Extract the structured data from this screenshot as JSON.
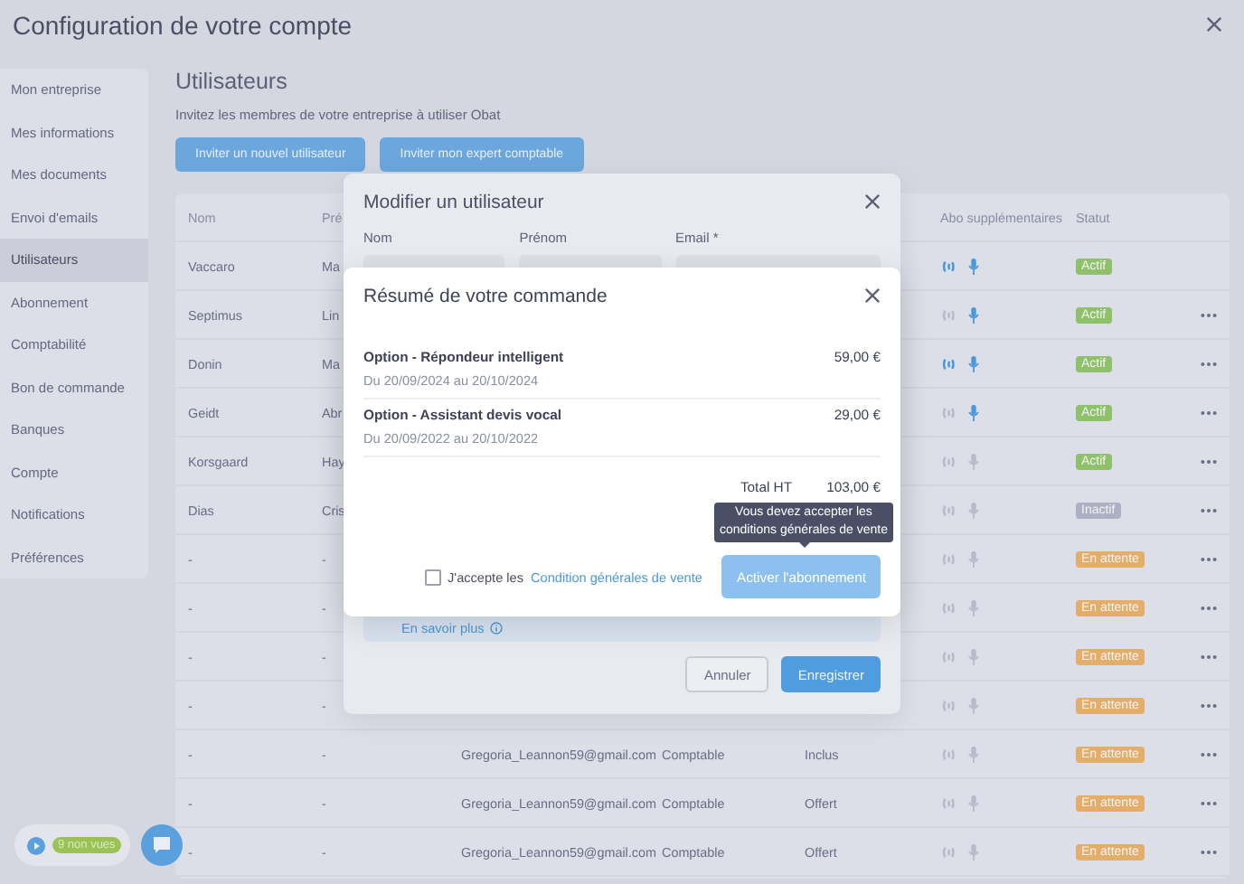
{
  "window": {
    "title": "Configuration de votre compte"
  },
  "sidebar": {
    "items": [
      {
        "label": "Mon entreprise",
        "selected": false
      },
      {
        "label": "Mes informations",
        "selected": false
      },
      {
        "label": "Mes documents",
        "selected": false
      },
      {
        "label": "Envoi d'emails",
        "selected": false
      },
      {
        "label": "Utilisateurs",
        "selected": true
      },
      {
        "label": "Abonnement",
        "selected": false
      },
      {
        "label": "Comptabilité",
        "selected": false
      },
      {
        "label": "Bon de commande",
        "selected": false
      },
      {
        "label": "Banques",
        "selected": false
      },
      {
        "label": "Compte",
        "selected": false
      },
      {
        "label": "Notifications",
        "selected": false
      },
      {
        "label": "Préférences",
        "selected": false
      }
    ]
  },
  "page": {
    "title": "Utilisateurs",
    "description": "Invitez les membres de votre entreprise à utiliser Obat",
    "buttons": [
      "Inviter un nouvel utilisateur",
      "Inviter mon expert comptable"
    ]
  },
  "table": {
    "columns": {
      "nom": "Nom",
      "prenom": "Pré",
      "abo": "Abo supplémentaires",
      "statut": "Statut"
    },
    "rows": [
      {
        "nom": "Vaccaro",
        "prenom": "Ma",
        "phone_active": true,
        "mic_active": true,
        "status": {
          "label": "Actif",
          "color": "#8fc06a"
        },
        "menu": false
      },
      {
        "nom": "Septimus",
        "prenom": "Lin",
        "phone_active": false,
        "mic_active": true,
        "status": {
          "label": "Actif",
          "color": "#8fc06a"
        },
        "menu": true
      },
      {
        "nom": "Donin",
        "prenom": "Ma",
        "phone_active": true,
        "mic_active": true,
        "status": {
          "label": "Actif",
          "color": "#8fc06a"
        },
        "menu": true
      },
      {
        "nom": "Geidt",
        "prenom": "Abr",
        "phone_active": false,
        "mic_active": true,
        "status": {
          "label": "Actif",
          "color": "#8fc06a"
        },
        "menu": true
      },
      {
        "nom": "Korsgaard",
        "prenom": "Hay",
        "phone_active": false,
        "mic_active": false,
        "status": {
          "label": "Actif",
          "color": "#8fc06a"
        },
        "menu": true
      },
      {
        "nom": "Dias",
        "prenom": "Cris",
        "phone_active": false,
        "mic_active": false,
        "status": {
          "label": "Inactif",
          "color": "#adb0c2"
        },
        "menu": true
      },
      {
        "nom": "-",
        "prenom": "-",
        "phone_active": false,
        "mic_active": false,
        "status": {
          "label": "En attente",
          "color": "#e3ad6a"
        },
        "menu": true
      },
      {
        "nom": "-",
        "prenom": "-",
        "phone_active": false,
        "mic_active": false,
        "status": {
          "label": "En attente",
          "color": "#e3ad6a"
        },
        "menu": true
      },
      {
        "nom": "-",
        "prenom": "-",
        "phone_active": false,
        "mic_active": false,
        "status": {
          "label": "En attente",
          "color": "#e3ad6a"
        },
        "menu": true
      },
      {
        "nom": "-",
        "prenom": "-",
        "phone_active": false,
        "mic_active": false,
        "status": {
          "label": "En attente",
          "color": "#e3ad6a"
        },
        "menu": true
      },
      {
        "nom": "-",
        "prenom": "-",
        "email": "Gregoria_Leannon59@gmail.com",
        "role": "Comptable",
        "offer": "Inclus",
        "phone_active": false,
        "mic_active": false,
        "status": {
          "label": "En attente",
          "color": "#e3ad6a"
        },
        "menu": true
      },
      {
        "nom": "-",
        "prenom": "-",
        "email": "Gregoria_Leannon59@gmail.com",
        "role": "Comptable",
        "offer": "Offert",
        "phone_active": false,
        "mic_active": false,
        "status": {
          "label": "En attente",
          "color": "#e3ad6a"
        },
        "menu": true
      },
      {
        "nom": "-",
        "prenom": "-",
        "email": "Gregoria_Leannon59@gmail.com",
        "role": "Comptable",
        "offer": "Offert",
        "phone_active": false,
        "mic_active": false,
        "status": {
          "label": "En attente",
          "color": "#e3ad6a"
        },
        "menu": true
      }
    ]
  },
  "edit_modal": {
    "title": "Modifier un utilisateur",
    "fields": [
      "Nom",
      "Prénom",
      "Email *"
    ],
    "info_link": "En savoir plus",
    "buttons": [
      {
        "label": "Annuler",
        "kind": "secondary"
      },
      {
        "label": "Enregistrer",
        "kind": "primary"
      }
    ]
  },
  "order_modal": {
    "title": "Résumé de votre commande",
    "items": [
      {
        "name": "Option - Répondeur intelligent",
        "period": "Du 20/09/2024 au 20/10/2024",
        "price": "59,00 €"
      },
      {
        "name": "Option - Assistant devis vocal",
        "period": "Du 20/09/2022 au 20/10/2022",
        "price": "29,00 €"
      }
    ],
    "totals": [
      {
        "label": "Total HT",
        "value": "103,00 €"
      }
    ],
    "tooltip": "Vous devez accepter les conditions générales de vente",
    "terms": {
      "label": "J'accepte les",
      "link": "Condition générales de vente",
      "checked": false
    },
    "submit": {
      "label": "Activer l'abonnement",
      "disabled": true
    }
  },
  "widget": {
    "badge": "9 non vues"
  }
}
